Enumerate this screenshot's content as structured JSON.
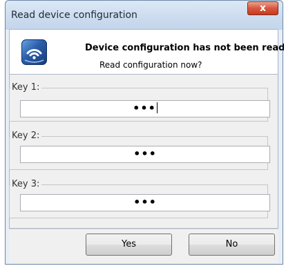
{
  "window": {
    "title": "Read device configuration",
    "close_glyph": "x"
  },
  "header": {
    "icon": "wifi-device-icon",
    "main_text": "Device configuration has not been read",
    "sub_text": "Read configuration now?"
  },
  "keys": [
    {
      "label": "Key 1:",
      "value": "•••",
      "focused": true
    },
    {
      "label": "Key 2:",
      "value": "•••",
      "focused": false
    },
    {
      "label": "Key 3:",
      "value": "•••",
      "focused": false
    }
  ],
  "buttons": {
    "yes_label": "Yes",
    "no_label": "No"
  },
  "colors": {
    "title_bar": "#cddcee",
    "close_button": "#d9573d",
    "header_icon": "#2b5da8"
  }
}
